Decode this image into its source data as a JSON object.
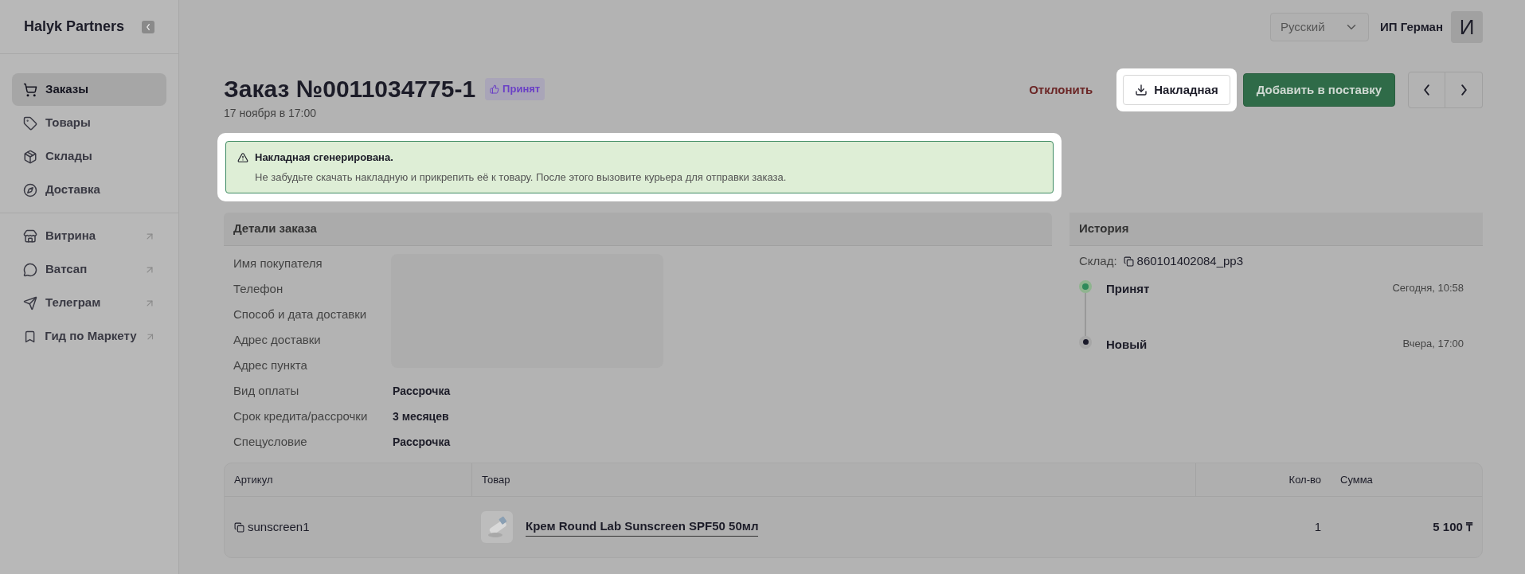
{
  "sidebar": {
    "logo": "Halyk Partners",
    "groups": [
      [
        {
          "label": "Заказы",
          "selected": true,
          "external": false
        },
        {
          "label": "Товары",
          "selected": false,
          "external": false
        },
        {
          "label": "Склады",
          "selected": false,
          "external": false
        },
        {
          "label": "Доставка",
          "selected": false,
          "external": false
        }
      ],
      [
        {
          "label": "Витрина",
          "selected": false,
          "external": true
        },
        {
          "label": "Ватсап",
          "selected": false,
          "external": true
        },
        {
          "label": "Телеграм",
          "selected": false,
          "external": true
        },
        {
          "label": "Гид по Маркету",
          "selected": false,
          "external": true
        }
      ]
    ]
  },
  "topbar": {
    "language": "Русский",
    "user": "ИП Герман",
    "avatar": "И"
  },
  "order": {
    "title": "Заказ №0011034775-1",
    "status": "Принят",
    "date": "17 ноября в 17:00"
  },
  "actions": {
    "reject": "Отклонить",
    "invoice": "Накладная",
    "add": "Добавить в поставку"
  },
  "alert": {
    "title": "Накладная сгенерирована.",
    "text": "Не забудьте скачать накладную и прикрепить её к товару. После этого вызовите курьера для отправки заказа."
  },
  "details": {
    "title": "Детали заказа",
    "rows": [
      {
        "label": "Имя покупателя"
      },
      {
        "label": "Телефон"
      },
      {
        "label": "Способ и дата доставки"
      },
      {
        "label": "Адрес доставки"
      },
      {
        "label": "Адрес пункта"
      },
      {
        "label": "Вид оплаты",
        "value": "Рассрочка"
      },
      {
        "label": "Срок кредита/рассрочки",
        "value": "3 месяцев"
      },
      {
        "label": "Спецусловие",
        "value": "Рассрочка"
      }
    ]
  },
  "history": {
    "title": "История",
    "warehouse_label": "Склад:",
    "warehouse": "860101402084_pp3",
    "events": [
      {
        "status": "Принят",
        "time": "Сегодня, 10:58",
        "current": true
      },
      {
        "status": "Новый",
        "time": "Вчера, 17:00",
        "current": false
      }
    ]
  },
  "table": {
    "columns": [
      "Артикул",
      "Товар",
      "Кол-во",
      "Сумма"
    ],
    "rows": [
      {
        "sku": "sunscreen1",
        "product": "Крем Round Lab Sunscreen SPF50 50мл",
        "qty": "1",
        "sum": "5 100 ₸"
      }
    ]
  }
}
